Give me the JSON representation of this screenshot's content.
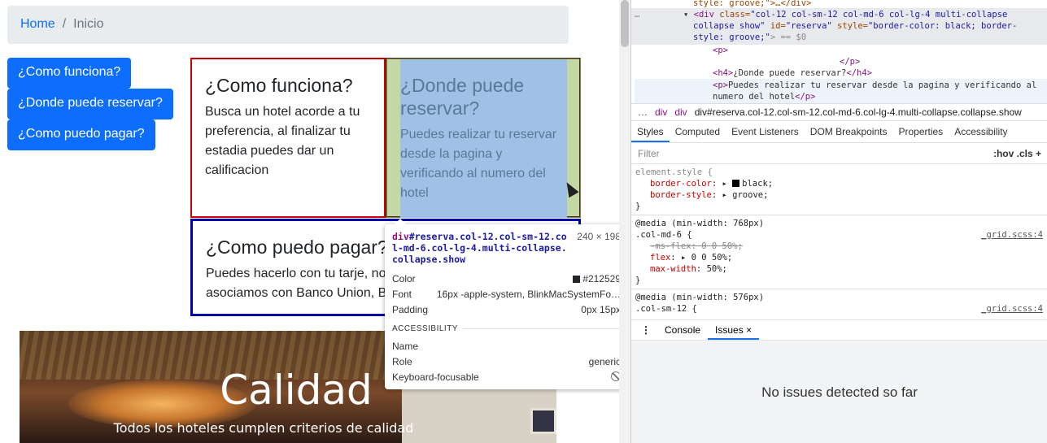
{
  "breadcrumb": {
    "home": "Home",
    "separator": "/",
    "current": "Inicio"
  },
  "buttons": [
    {
      "label": "¿Como funciona?"
    },
    {
      "label": "¿Donde puede reservar?"
    },
    {
      "label": "¿Como puedo pagar?"
    }
  ],
  "cards": [
    {
      "title": "¿Como funciona?",
      "text": "Busca un hotel acorde a tu preferencia, al finalizar tu estadia puedes dar un calificacion"
    },
    {
      "title": "¿Donde puede reservar?",
      "text": "Puedes realizar tu reservar desde la pagina y verificando al numero del hotel"
    },
    {
      "title": "¿Como puedo pagar?",
      "text": "Puedes hacerlo con tu tarje, nos asociamos con Banco Union, BNB y Bisa"
    }
  ],
  "carousel": {
    "heading": "Calidad",
    "caption": "Todos los hoteles cumplen criterios de calidad"
  },
  "tooltip": {
    "tag": "div",
    "selector": "#reserva.col-12.col-sm-12.col-md-6.col-lg-4.multi-collapse.collapse.show",
    "dimensions": "240 × 198",
    "rows": [
      {
        "key": "Color",
        "value": "#212529"
      },
      {
        "key": "Font",
        "value": "16px -apple-system, BlinkMacSystemFo…"
      },
      {
        "key": "Padding",
        "value": "0px 15px"
      }
    ],
    "accessibility_label": "ACCESSIBILITY",
    "a11y_rows": [
      {
        "key": "Name",
        "value": ""
      },
      {
        "key": "Role",
        "value": "generic"
      },
      {
        "key": "Keyboard-focusable",
        "value": ""
      }
    ],
    "color_swatch": "#212529"
  },
  "devtools": {
    "dom_lines": {
      "l0": "style: groove;\">…</div>",
      "l1_tag": "<div",
      "l1_class_attr": "class=",
      "l1_class_val": "\"col-12 col-sm-12 col-md-6 col-lg-4 multi-collapse",
      "l2": "collapse show\"",
      "l2_id_attr": "id=",
      "l2_id_val": "\"reserva\"",
      "l2_style_attr": "style=",
      "l2_style_val": "\"border-color: black; border-",
      "l3": "style: groove;\"",
      "l3_end": "> == $0",
      "l4": "<p>",
      "l5": "</p>",
      "l6_open": "<h4>",
      "l6_text": "¿Donde puede reservar?",
      "l6_close": "</h4>",
      "l7_open": "<p>",
      "l7_text": "Puedes realizar tu reservar desde la pagina y verificando al",
      "l8_text": "numero del hotel",
      "l8_close": "</p>"
    },
    "dots": "…",
    "crumbs": [
      "…",
      "div",
      "div",
      "div#reserva.col-12.col-sm-12.col-md-6.col-lg-4.multi-collapse.collapse.show"
    ],
    "tabs": [
      "Styles",
      "Computed",
      "Event Listeners",
      "DOM Breakpoints",
      "Properties",
      "Accessibility"
    ],
    "filter_placeholder": "Filter",
    "filter_tools": ":hov  .cls  +",
    "styles": {
      "r1_sel": "element.style {",
      "r1_p1_name": "border-color",
      "r1_p1_val": "black;",
      "r1_p2_name": "border-style",
      "r1_p2_val": "groove;",
      "close": "}",
      "r2_media": "@media (min-width: 768px)",
      "r2_sel": ".col-md-6 {",
      "r2_src": "_grid.scss:4",
      "r2_p1": "-ms-flex: 0 0 50%;",
      "r2_p2_name": "flex",
      "r2_p2_val": "0 0 50%;",
      "r2_p3_name": "max-width",
      "r2_p3_val": "50%;",
      "r3_media": "@media (min-width: 576px)",
      "r3_sel": ".col-sm-12 {",
      "r3_src": "_grid.scss:4"
    },
    "drawer_tabs": [
      "Console",
      "Issues"
    ],
    "drawer_close": "×",
    "issues_text": "No issues detected so far"
  }
}
